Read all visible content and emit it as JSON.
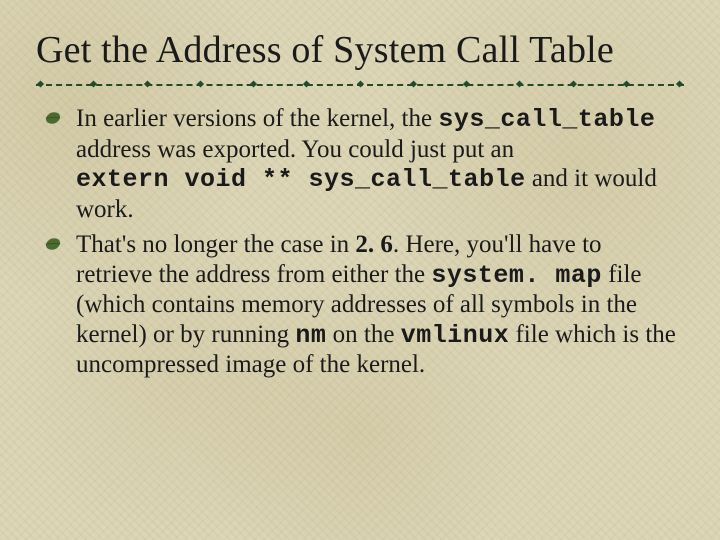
{
  "title": "Get the Address of System Call Table",
  "bullets": [
    {
      "segments": [
        {
          "t": "In earlier versions of the kernel, the "
        },
        {
          "t": "sys_call_table",
          "cls": "mono"
        },
        {
          "t": " address was exported. You could just put an"
        },
        {
          "t": "\n"
        },
        {
          "t": "extern void ** sys_call_table",
          "cls": "mono"
        },
        {
          "t": " and it would work."
        }
      ]
    },
    {
      "segments": [
        {
          "t": "That's no longer the case in "
        },
        {
          "t": "2. 6",
          "cls": "bold"
        },
        {
          "t": ". Here, you'll have to retrieve the address from either the "
        },
        {
          "t": "system. map",
          "cls": "mono"
        },
        {
          "t": " file (which contains memory addresses of all symbols in the kernel) or by running "
        },
        {
          "t": "nm",
          "cls": "mono"
        },
        {
          "t": " on the "
        },
        {
          "t": "vmlinux",
          "cls": "mono"
        },
        {
          "t": " file which is the uncompressed image of the kernel."
        }
      ]
    }
  ]
}
